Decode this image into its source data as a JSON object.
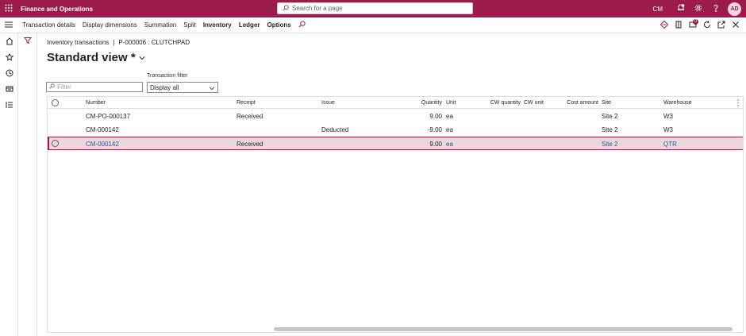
{
  "topbar": {
    "app_title": "Finance and Operations",
    "search_placeholder": "Search for a page",
    "company": "CM",
    "user_initials": "AD",
    "brand_color": "#9b1b4a"
  },
  "actionbar": {
    "items": [
      {
        "label": "Transaction details",
        "bold": false
      },
      {
        "label": "Display dimensions",
        "bold": false
      },
      {
        "label": "Summation",
        "bold": false
      },
      {
        "label": "Split",
        "bold": false
      },
      {
        "label": "Inventory",
        "bold": true
      },
      {
        "label": "Ledger",
        "bold": true
      },
      {
        "label": "Options",
        "bold": true
      }
    ],
    "notification_count": "0"
  },
  "page": {
    "breadcrumb_1": "Inventory transactions",
    "breadcrumb_sep": "|",
    "breadcrumb_2": "P-000006 : CLUTCHPAD",
    "view_title": "Standard view *",
    "filter_placeholder": "Filter",
    "transaction_filter_label": "Transaction filter",
    "transaction_filter_value": "Display all"
  },
  "grid": {
    "headers": {
      "number": "Number",
      "receipt": "Receipt",
      "issue": "Issue",
      "quantity": "Quantity",
      "unit": "Unit",
      "cw_quantity": "CW quantity",
      "cw_unit": "CW unit",
      "cost_amount": "Cost amount",
      "site": "Site",
      "warehouse": "Warehouse"
    },
    "rows": [
      {
        "number": "CM-PO-000137",
        "receipt": "Received",
        "issue": "",
        "quantity": "9.00",
        "unit": "ea",
        "cw_quantity": "",
        "cw_unit": "",
        "cost_amount": "",
        "site": "Site 2",
        "warehouse": "W3"
      },
      {
        "number": "CM-000142",
        "receipt": "",
        "issue": "Deducted",
        "quantity": "-9.00",
        "unit": "ea",
        "cw_quantity": "",
        "cw_unit": "",
        "cost_amount": "",
        "site": "Site 2",
        "warehouse": "W3"
      },
      {
        "number": "CM-000142",
        "receipt": "Received",
        "issue": "",
        "quantity": "9.00",
        "unit": "ea",
        "cw_quantity": "",
        "cw_unit": "",
        "cost_amount": "",
        "site": "Site 2",
        "warehouse": "QTR"
      }
    ],
    "selected_row": 2
  }
}
